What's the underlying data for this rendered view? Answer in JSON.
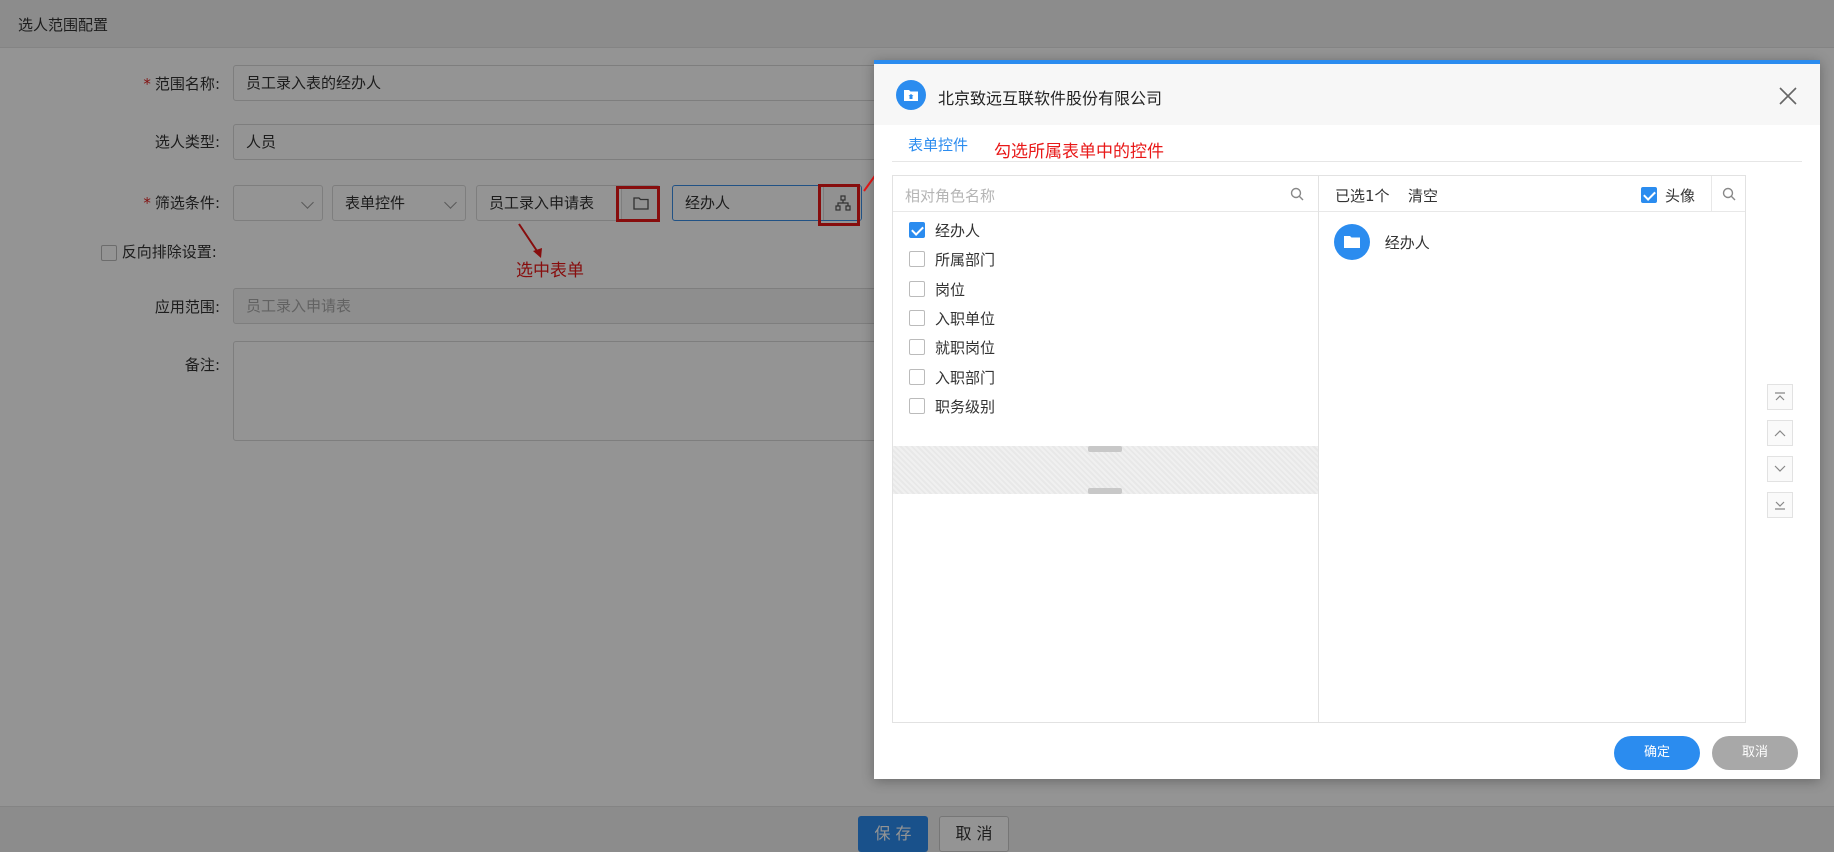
{
  "page": {
    "title": "选人范围配置"
  },
  "form": {
    "scope_name": {
      "label": "范围名称",
      "value": "员工录入表的经办人"
    },
    "selection_type": {
      "label": "选人类型",
      "value": "人员"
    },
    "filter": {
      "label": "筛选条件",
      "select1_value": "",
      "select2_value": "表单控件",
      "form_value": "员工录入申请表",
      "control_value": "经办人"
    },
    "reverse_exclude": {
      "label": "反向排除设置"
    },
    "apply_scope": {
      "label": "应用范围",
      "placeholder": "员工录入申请表"
    },
    "remark": {
      "label": "备注"
    }
  },
  "annotations": {
    "select_form": "选中表单",
    "check_control": "勾选所属表单中的控件"
  },
  "footer": {
    "save_label": "保 存",
    "cancel_label": "取 消"
  },
  "dialog": {
    "title": "北京致远互联软件股份有限公司",
    "tab_label": "表单控件",
    "search_placeholder": "相对角色名称",
    "items": [
      {
        "label": "经办人",
        "checked": true
      },
      {
        "label": "所属部门",
        "checked": false
      },
      {
        "label": "岗位",
        "checked": false
      },
      {
        "label": "入职单位",
        "checked": false
      },
      {
        "label": "就职岗位",
        "checked": false
      },
      {
        "label": "入职部门",
        "checked": false
      },
      {
        "label": "职务级别",
        "checked": false
      }
    ],
    "selected_count": "已选1个",
    "clear_label": "清空",
    "avatar_label": "头像",
    "selected_items": [
      {
        "label": "经办人"
      }
    ],
    "confirm_label": "确定",
    "cancel_label": "取消"
  },
  "colors": {
    "accent": "#2b8cef",
    "annotation": "#e81818"
  }
}
